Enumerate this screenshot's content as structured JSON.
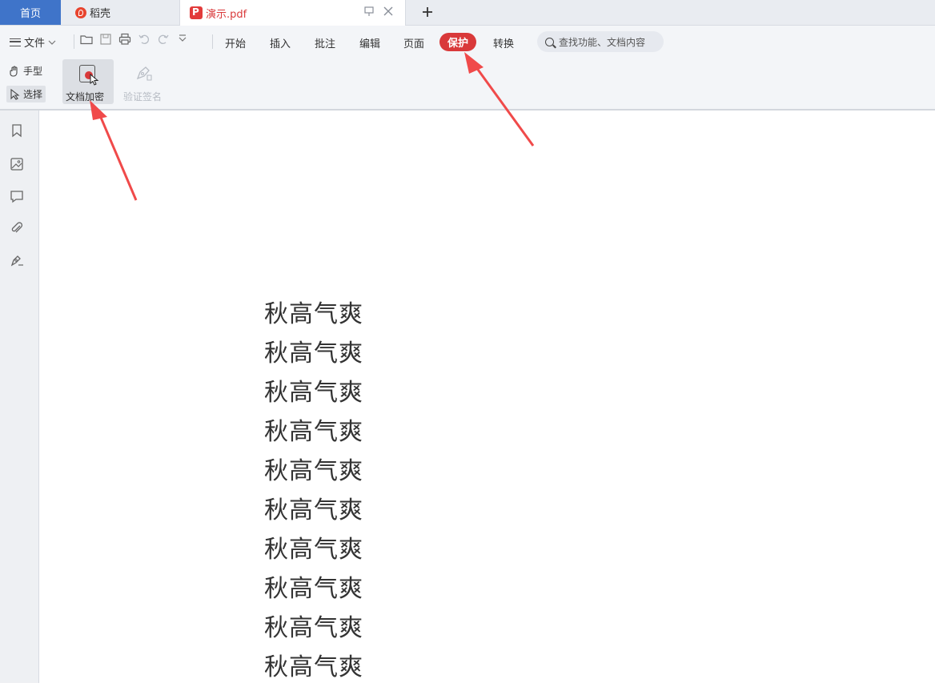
{
  "tabs": {
    "home": "首页",
    "daoke": "稻壳",
    "document": "演示.pdf"
  },
  "menu": {
    "file": "文件",
    "items": [
      "开始",
      "插入",
      "批注",
      "编辑",
      "页面",
      "保护",
      "转换"
    ],
    "active": "保护",
    "search_placeholder": "查找功能、文档内容"
  },
  "ribbon": {
    "hand": "手型",
    "select": "选择",
    "encrypt": "文档加密",
    "verify": "验证签名"
  },
  "document": {
    "lines": [
      "秋高气爽",
      "秋高气爽",
      "秋高气爽",
      "秋高气爽",
      "秋高气爽",
      "秋高气爽",
      "秋高气爽",
      "秋高气爽",
      "秋高气爽",
      "秋高气爽"
    ]
  },
  "colors": {
    "accent": "#3f74c9",
    "protect_active": "#d9393a",
    "annotation_arrow": "#f04a4a"
  }
}
